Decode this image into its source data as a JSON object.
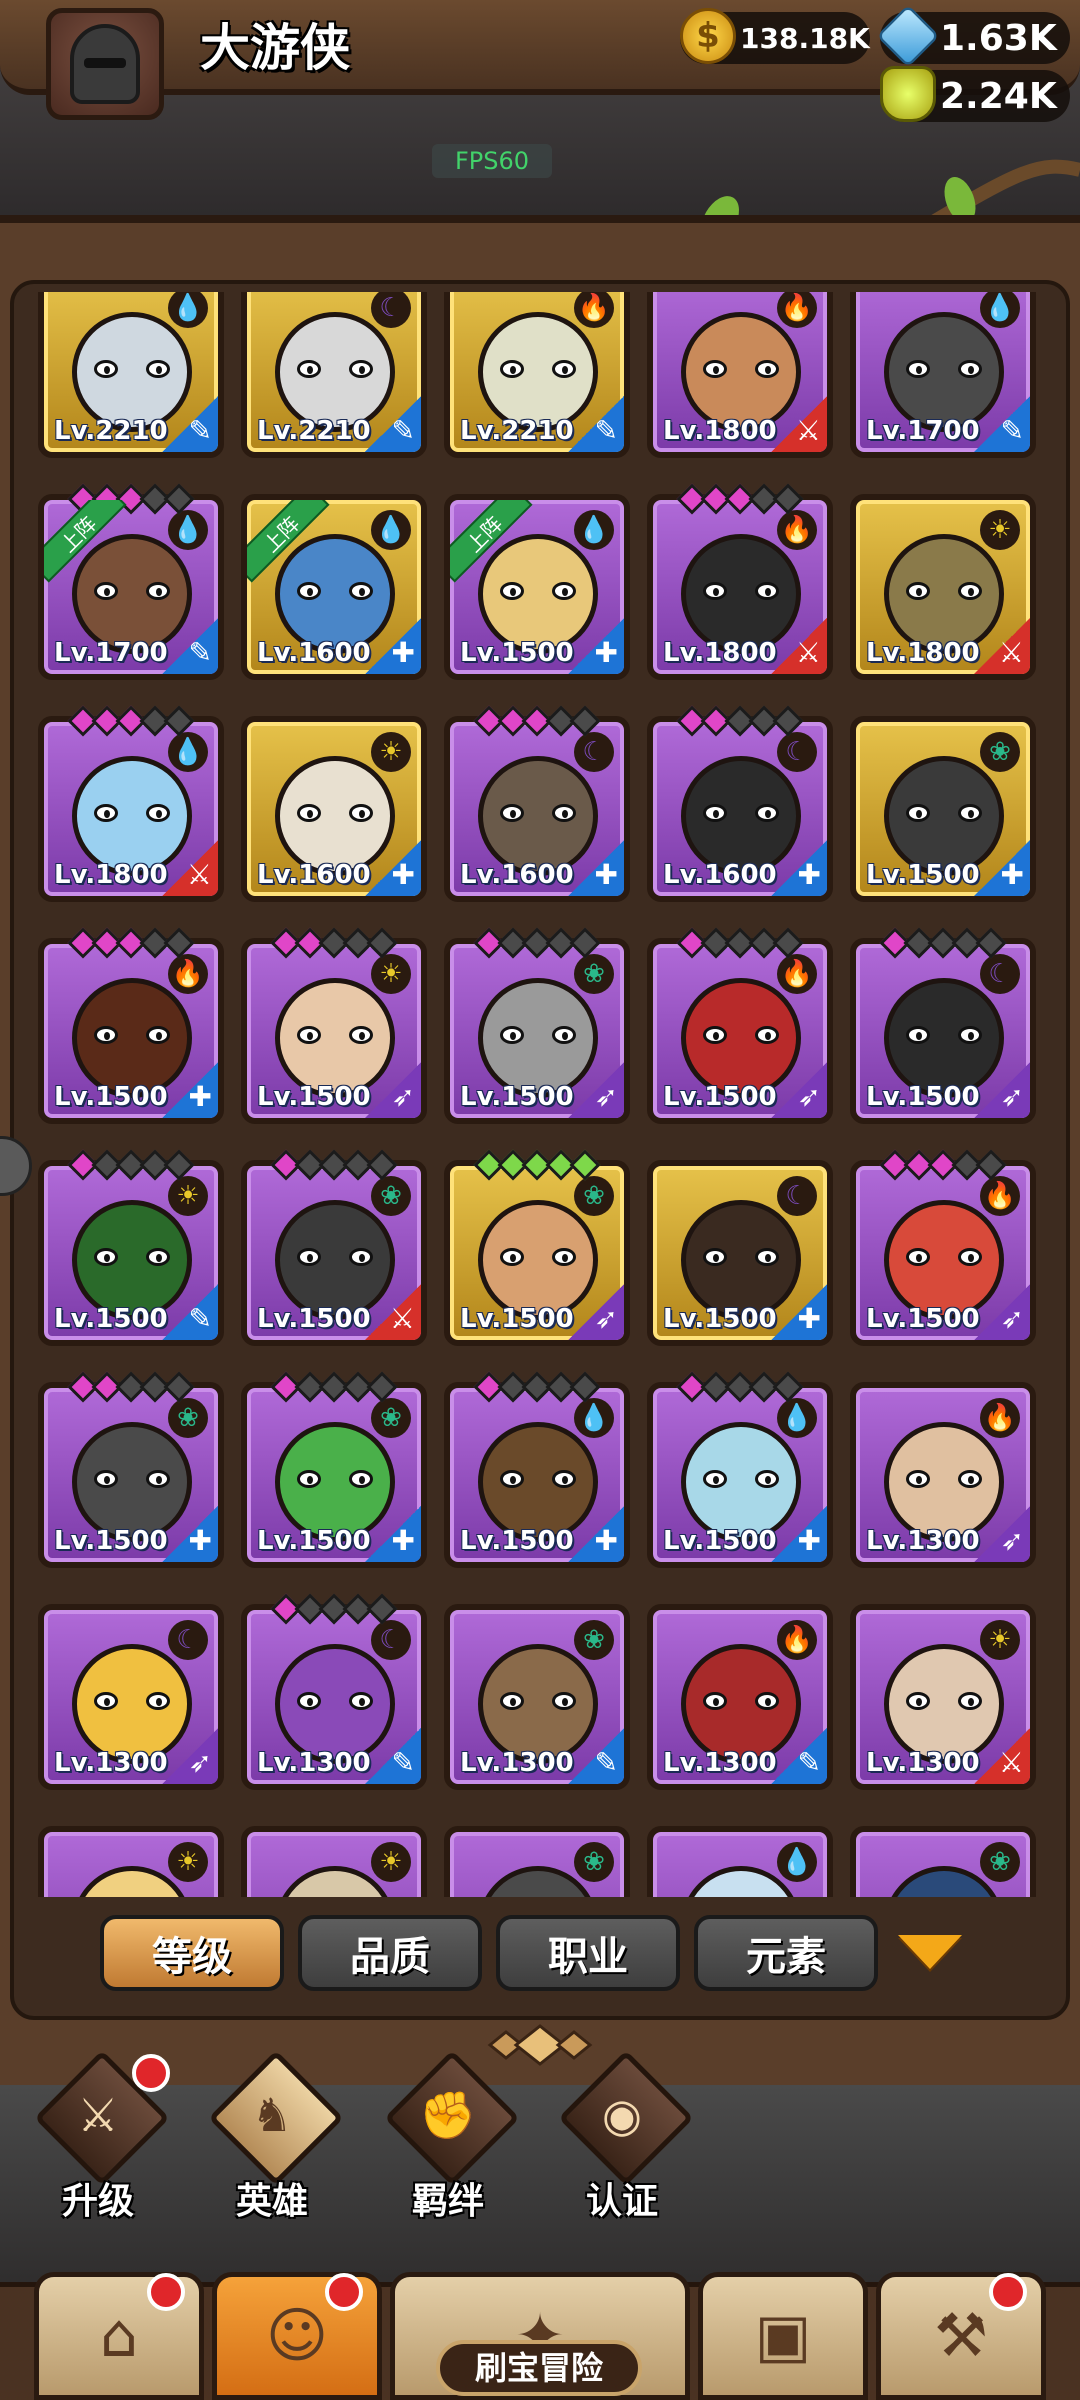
{
  "header": {
    "player_name": "大游侠",
    "gold": "138.18K",
    "gems": "1.63K",
    "potion": "2.24K",
    "fps": "FPS60"
  },
  "heroes": [
    {
      "level": "Lv.2210",
      "frame": "gold",
      "element": "water",
      "class": "mage",
      "stars": 0,
      "color": "#cfd8e0"
    },
    {
      "level": "Lv.2210",
      "frame": "gold",
      "element": "dark",
      "class": "mage",
      "stars": 0,
      "color": "#d8d8d8"
    },
    {
      "level": "Lv.2210",
      "frame": "gold",
      "element": "fire",
      "class": "mage",
      "stars": 0,
      "color": "#e0e0c8"
    },
    {
      "level": "Lv.1800",
      "frame": "purple",
      "element": "fire",
      "class": "warrior",
      "stars": 0,
      "color": "#c98a5a"
    },
    {
      "level": "Lv.1700",
      "frame": "purple",
      "element": "water",
      "class": "mage",
      "stars": 0,
      "color": "#4a4a4a"
    },
    {
      "level": "Lv.1700",
      "frame": "purple",
      "element": "water",
      "class": "mage",
      "stars": 3,
      "color": "#7a5038",
      "deployed": "上阵"
    },
    {
      "level": "Lv.1600",
      "frame": "gold",
      "element": "water",
      "class": "paladin",
      "stars": 0,
      "color": "#4a86c8",
      "deployed": "上阵"
    },
    {
      "level": "Lv.1500",
      "frame": "purple",
      "element": "water",
      "class": "paladin",
      "stars": 0,
      "color": "#e8c87a",
      "deployed": "上阵"
    },
    {
      "level": "Lv.1800",
      "frame": "purple",
      "element": "fire",
      "class": "warrior",
      "stars": 3,
      "color": "#2a2a2a"
    },
    {
      "level": "Lv.1800",
      "frame": "gold",
      "element": "light",
      "class": "warrior",
      "stars": 0,
      "color": "#8a7a4a"
    },
    {
      "level": "Lv.1800",
      "frame": "purple",
      "element": "water",
      "class": "warrior",
      "stars": 3,
      "color": "#9ad0f0"
    },
    {
      "level": "Lv.1600",
      "frame": "gold",
      "element": "light",
      "class": "paladin",
      "stars": 0,
      "color": "#e8e0d0"
    },
    {
      "level": "Lv.1600",
      "frame": "purple",
      "element": "dark",
      "class": "paladin",
      "stars": 3,
      "color": "#6a5a4a"
    },
    {
      "level": "Lv.1600",
      "frame": "purple",
      "element": "dark",
      "class": "paladin",
      "stars": 2,
      "color": "#2a2a2a"
    },
    {
      "level": "Lv.1500",
      "frame": "gold",
      "element": "wind",
      "class": "paladin",
      "stars": 0,
      "color": "#3a3a3a"
    },
    {
      "level": "Lv.1500",
      "frame": "purple",
      "element": "fire",
      "class": "paladin",
      "stars": 3,
      "color": "#5a2a18"
    },
    {
      "level": "Lv.1500",
      "frame": "purple",
      "element": "light",
      "class": "archer",
      "stars": 2,
      "color": "#e8c8a8"
    },
    {
      "level": "Lv.1500",
      "frame": "purple",
      "element": "wind",
      "class": "archer",
      "stars": 1,
      "color": "#9a9a9a"
    },
    {
      "level": "Lv.1500",
      "frame": "purple",
      "element": "fire",
      "class": "archer",
      "stars": 1,
      "color": "#b82a2a"
    },
    {
      "level": "Lv.1500",
      "frame": "purple",
      "element": "dark",
      "class": "archer",
      "stars": 1,
      "color": "#2a2a2a"
    },
    {
      "level": "Lv.1500",
      "frame": "purple",
      "element": "light",
      "class": "mage",
      "stars": 1,
      "color": "#2a6a2a"
    },
    {
      "level": "Lv.1500",
      "frame": "purple",
      "element": "wind",
      "class": "warrior",
      "stars": 1,
      "color": "#3a3a3a"
    },
    {
      "level": "Lv.1500",
      "frame": "gold",
      "element": "wind",
      "class": "archer",
      "stars": 5,
      "color": "#d8a070",
      "green": true
    },
    {
      "level": "Lv.1500",
      "frame": "gold",
      "element": "dark",
      "class": "paladin",
      "stars": 0,
      "color": "#3a2a20"
    },
    {
      "level": "Lv.1500",
      "frame": "purple",
      "element": "fire",
      "class": "archer",
      "stars": 3,
      "color": "#d84a3a"
    },
    {
      "level": "Lv.1500",
      "frame": "purple",
      "element": "wind",
      "class": "paladin",
      "stars": 2,
      "color": "#4a4a4a"
    },
    {
      "level": "Lv.1500",
      "frame": "purple",
      "element": "wind",
      "class": "paladin",
      "stars": 1,
      "color": "#4ab04a"
    },
    {
      "level": "Lv.1500",
      "frame": "purple",
      "element": "water",
      "class": "paladin",
      "stars": 1,
      "color": "#6a4a2a"
    },
    {
      "level": "Lv.1500",
      "frame": "purple",
      "element": "water",
      "class": "paladin",
      "stars": 1,
      "color": "#a8d8e8"
    },
    {
      "level": "Lv.1300",
      "frame": "purple",
      "element": "fire",
      "class": "archer",
      "stars": 0,
      "color": "#e0c0a0"
    },
    {
      "level": "Lv.1300",
      "frame": "purple",
      "element": "dark",
      "class": "archer",
      "stars": 0,
      "color": "#f0c040"
    },
    {
      "level": "Lv.1300",
      "frame": "purple",
      "element": "dark",
      "class": "mage",
      "stars": 1,
      "color": "#8a4ab8"
    },
    {
      "level": "Lv.1300",
      "frame": "purple",
      "element": "wind",
      "class": "mage",
      "stars": 0,
      "color": "#8a6a4a"
    },
    {
      "level": "Lv.1300",
      "frame": "purple",
      "element": "fire",
      "class": "mage",
      "stars": 0,
      "color": "#a82a2a"
    },
    {
      "level": "Lv.1300",
      "frame": "purple",
      "element": "light",
      "class": "warrior",
      "stars": 0,
      "color": "#e0c8b0"
    },
    {
      "level": "",
      "frame": "purple",
      "element": "light",
      "class": "warrior",
      "stars": 0,
      "color": "#f0d080"
    },
    {
      "level": "",
      "frame": "purple",
      "element": "light",
      "class": "warrior",
      "stars": 0,
      "color": "#d8c8a8"
    },
    {
      "level": "",
      "frame": "purple",
      "element": "wind",
      "class": "warrior",
      "stars": 0,
      "color": "#4a4a4a"
    },
    {
      "level": "",
      "frame": "purple",
      "element": "water",
      "class": "warrior",
      "stars": 0,
      "color": "#c8e0f0"
    },
    {
      "level": "",
      "frame": "purple",
      "element": "wind",
      "class": "warrior",
      "stars": 0,
      "color": "#2a4a7a"
    }
  ],
  "sort_tabs": [
    "等级",
    "品质",
    "职业",
    "元素"
  ],
  "subnav": [
    "升级",
    "英雄",
    "羁绊",
    "认证"
  ],
  "bottom_nav": {
    "adventure_label": "刷宝冒险"
  },
  "colors": {
    "element_water": "#2a7ad8",
    "element_fire": "#e23a2a",
    "element_light": "#e8c82a",
    "element_dark": "#7a4ab8",
    "element_wind": "#2ab88a",
    "class_mage": "#1e74d6",
    "class_warrior": "#d6302a",
    "class_paladin": "#1e74d6",
    "class_archer": "#7a3ab8"
  }
}
